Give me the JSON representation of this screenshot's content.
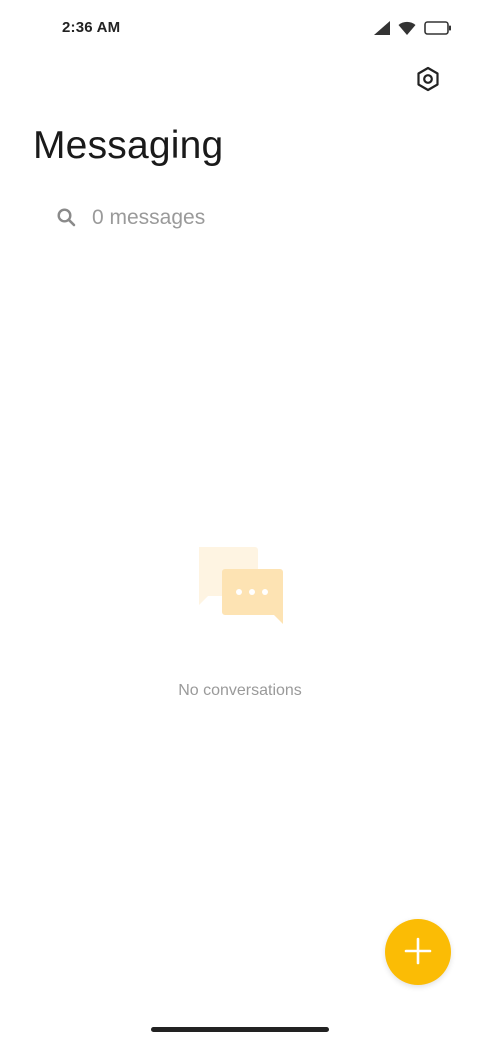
{
  "status_bar": {
    "time": "2:36 AM",
    "icons": [
      "cellular-signal-icon",
      "wifi-icon",
      "battery-icon"
    ]
  },
  "header": {
    "title": "Messaging",
    "settings_icon": "settings-hexagon-icon"
  },
  "search": {
    "placeholder": "0 messages",
    "value": "",
    "icon": "search-icon"
  },
  "empty_state": {
    "icon": "chat-bubbles-icon",
    "text": "No conversations"
  },
  "fab": {
    "icon": "plus-icon"
  },
  "colors": {
    "accent": "#FBBC05",
    "illustration_front": "#FDE3B3",
    "illustration_back": "#FEF4E2",
    "text_secondary": "#9A9A9A"
  }
}
